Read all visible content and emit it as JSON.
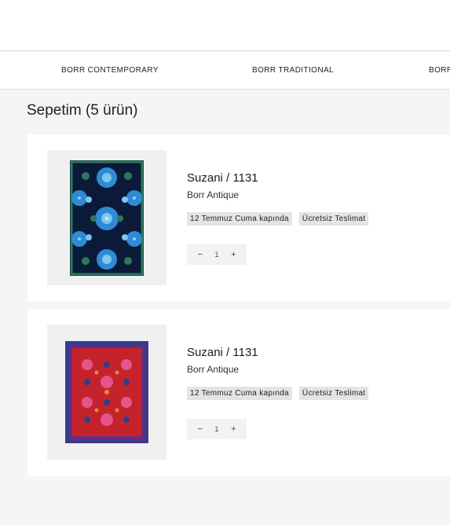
{
  "nav": {
    "categories": [
      "BORR CONTEMPORARY",
      "BORR TRADITIONAL",
      "BORR"
    ]
  },
  "cart": {
    "title": "Sepetim (5 ürün)",
    "items": [
      {
        "name": "Suzani / 1131",
        "brand": "Borr Antique",
        "delivery": "12 Temmuz Cuma kapında",
        "shipping": "Ücretsiz Teslimat",
        "quantity": "1",
        "minus": "−",
        "plus": "+",
        "palette": [
          "#0c1a3a",
          "#2e8bd6",
          "#2b7a5a",
          "#7fc7ee"
        ]
      },
      {
        "name": "Suzani / 1131",
        "brand": "Borr Antique",
        "delivery": "12 Temmuz Cuma kapında",
        "shipping": "Ücretsiz Teslimat",
        "quantity": "1",
        "minus": "−",
        "plus": "+",
        "palette": [
          "#c5232b",
          "#6e2a7a",
          "#e5558c",
          "#2d3f8f"
        ]
      }
    ]
  }
}
